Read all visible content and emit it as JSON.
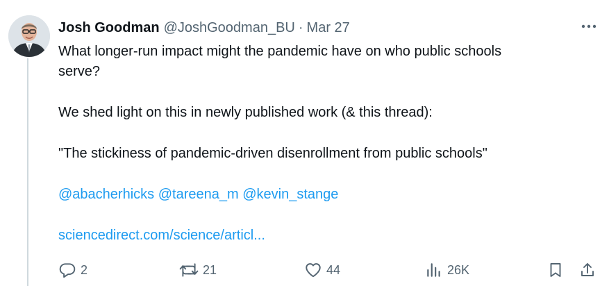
{
  "author": {
    "name": "Josh Goodman",
    "handle": "@JoshGoodman_BU",
    "separator": "·",
    "date": "Mar 27"
  },
  "tweet": {
    "question_line1": "What longer-run impact might the pandemic have on who public schools",
    "question_line2": "serve?",
    "paragraph2": "We shed light on this in newly published work (& this thread):",
    "paper_title": "\"The stickiness of pandemic-driven disenrollment from public schools\"",
    "mentions": [
      "@abacherhicks",
      "@tareena_m",
      "@kevin_stange"
    ],
    "link": "sciencedirect.com/science/articl..."
  },
  "actions": {
    "replies": "2",
    "retweets": "21",
    "likes": "44",
    "views": "26K"
  },
  "icons": {
    "more": "more-dots-icon",
    "reply": "reply-icon",
    "retweet": "retweet-icon",
    "like": "heart-icon",
    "views": "views-icon",
    "bookmark": "bookmark-icon",
    "share": "share-icon"
  },
  "colors": {
    "text": "#0f1419",
    "secondary": "#536471",
    "link": "#1d9bf0",
    "thread_line": "#cfd9de"
  }
}
